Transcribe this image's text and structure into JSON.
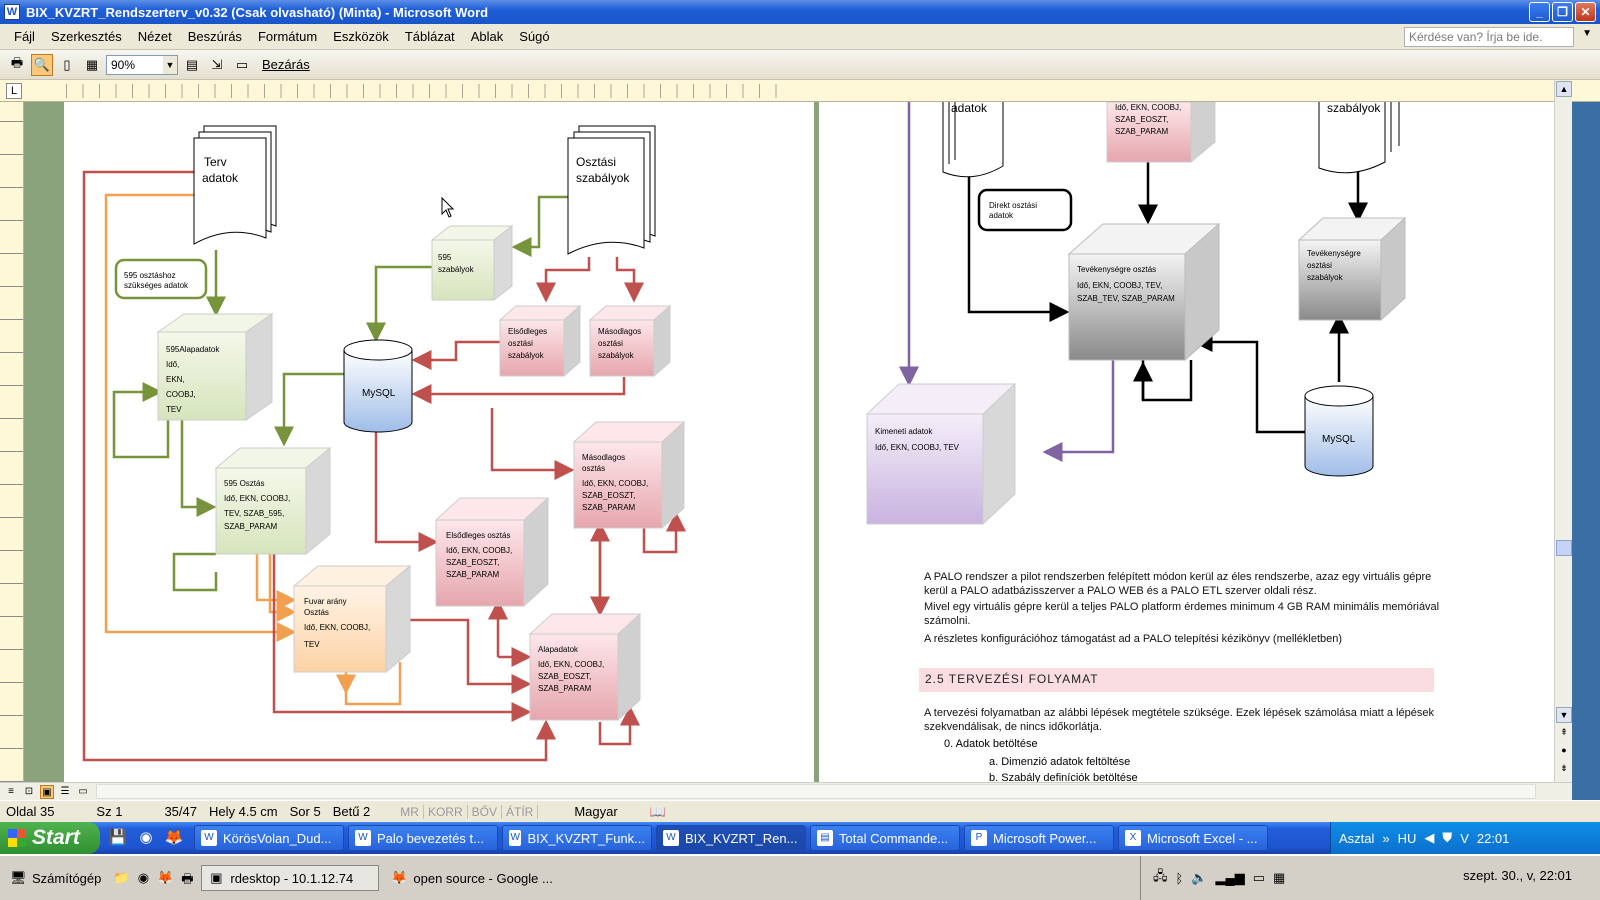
{
  "window": {
    "title": "BIX_KVZRT_Rendszerterv_v0.32 (Csak olvasható) (Minta) - Microsoft Word"
  },
  "menu": {
    "items": [
      "Fájl",
      "Szerkesztés",
      "Nézet",
      "Beszúrás",
      "Formátum",
      "Eszközök",
      "Táblázat",
      "Ablak",
      "Súgó"
    ],
    "help_placeholder": "Kérdése van? Írja be ide."
  },
  "toolbar": {
    "zoom": "90%",
    "close_label": "Bezárás"
  },
  "diagram_left": {
    "terv": "Terv\nadatok",
    "osztasi": "Osztási\nszabályok",
    "note595": "595 osztáshoz\nszükséges adatok",
    "szab595": "595\nszabályok",
    "alap595": "595Alapadatok\nIdő,\nEKN,\nCOOBJ,\nTEV",
    "mysql": "MySQL",
    "elsodleges_szab": "Elsődleges\nosztási\nszabályok",
    "masodlagos_szab": "Másodlagos\nosztási\nszabályok",
    "osztas595": "595 Osztás\nIdő, EKN, COOBJ,\nTEV, SZAB_595,\nSZAB_PARAM",
    "masodlagos_osztas": "Másodlagos\nosztás\nIdő, EKN, COOBJ,\nSZAB_EOSZT,\nSZAB_PARAM",
    "elsodleges_osztas": "Elsődleges osztás\nIdő, EKN, COOBJ,\nSZAB_EOSZT,\nSZAB_PARAM",
    "fuvar": "Fuvar arány\nOsztás\nIdő, EKN, COOBJ,\nTEV",
    "alapadatok": "Alapadatok\nIdő, EKN, COOBJ,\nSZAB_EOSZT,\nSZAB_PARAM"
  },
  "diagram_right": {
    "adatok": "adatok",
    "top_pink": "Idő, EKN, COOBJ,\nSZAB_EOSZT,\nSZAB_PARAM",
    "szabalyok": "szabályok",
    "direkt": "Direkt osztási\nadatok",
    "tev_osztas": "Tevékenységre osztás\nIdő, EKN, COOBJ, TEV,\nSZAB_TEV, SZAB_PARAM",
    "tev_szab": "Tevékenységre\nosztási\nszabályok",
    "kimenet": "Kimeneti adatok\nIdő, EKN, COOBJ, TEV",
    "mysql": "MySQL"
  },
  "page2": {
    "p1": "A PALO rendszer a pilot rendszerben felépített módon kerül az éles rendszerbe, azaz egy virtuális gépre kerül a PALO adatbázisszerver a PALO WEB és a PALO ETL szerver oldali rész.",
    "p2": "Mivel egy virtuális gépre kerül a teljes PALO platform érdemes minimum 4 GB RAM minimális memóriával számolni.",
    "p3": "A részletes konfigurációhoz támogatást ad a PALO telepítési kézikönyv (mellékletben)",
    "heading": "2.5   TERVEZÉSI FOLYAMAT",
    "p4": "A tervezési folyamatban az alábbi lépések megtétele szüksége. Ezek lépések számolása miatt a lépések szekvendálisak, de nincs időkorlátja.",
    "l0": "0.     Adatok betöltése",
    "la": "a.     Dimenzió adatok feltöltése",
    "lb": "b.     Szabály definíciók betöltése"
  },
  "status": {
    "oldal": "Oldal 35",
    "sz": "Sz 1",
    "of": "35/47",
    "hely": "Hely 4.5 cm",
    "sor": "Sor 5",
    "betu": "Betű 2",
    "mr": "MR",
    "korr": "KORR",
    "bov": "BŐV",
    "atir": "ÁTÍR",
    "lang": "Magyar"
  },
  "taskbar": {
    "start": "Start",
    "tasks": [
      "KörösVolan_Dud...",
      "Palo bevezetés t...",
      "BIX_KVZRT_Funk...",
      "BIX_KVZRT_Ren...",
      "Total Commande...",
      "Microsoft Power...",
      "Microsoft Excel - ..."
    ],
    "tray_label": "Asztal",
    "lang": "HU",
    "clock": "22:01"
  },
  "taskbar2": {
    "computer": "Számítógép",
    "rdesktop": "rdesktop - 10.1.12.74",
    "browser": "open source - Google ...",
    "date": "szept. 30., v, 22:01"
  }
}
